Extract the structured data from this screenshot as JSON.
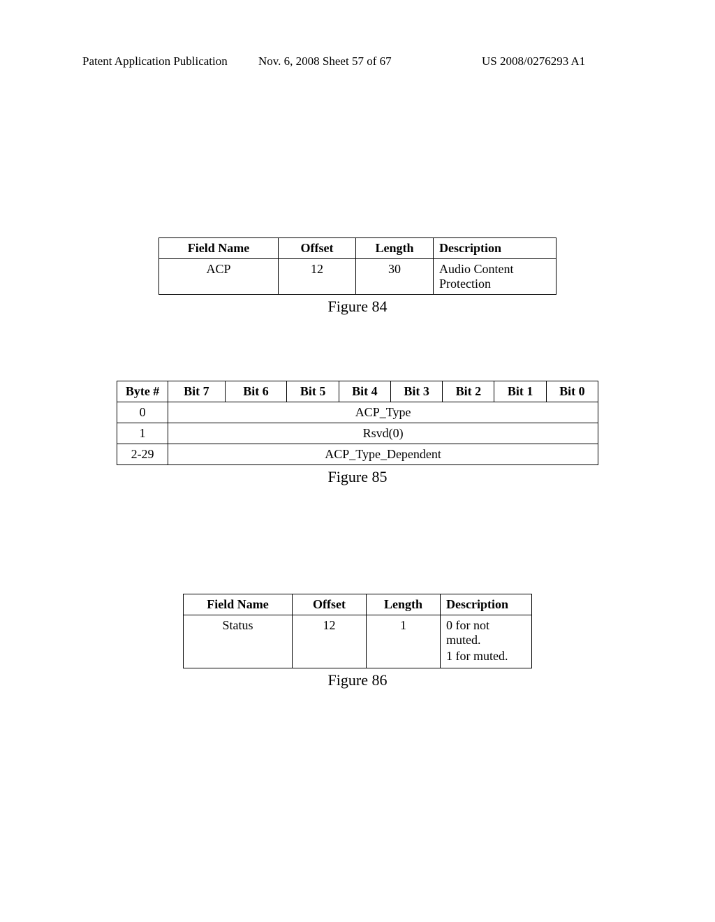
{
  "header": {
    "left": "Patent Application Publication",
    "center": "Nov. 6, 2008  Sheet 57 of 67",
    "right": "US 2008/0276293 A1"
  },
  "figure84": {
    "caption": "Figure 84",
    "headers": {
      "field": "Field Name",
      "offset": "Offset",
      "length": "Length",
      "desc": "Description"
    },
    "row": {
      "field": "ACP",
      "offset": "12",
      "length": "30",
      "desc": "Audio Content Protection"
    }
  },
  "figure85": {
    "caption": "Figure 85",
    "headers": {
      "byte": "Byte #",
      "b7": "Bit 7",
      "b6": "Bit 6",
      "b5": "Bit 5",
      "b4": "Bit 4",
      "b3": "Bit 3",
      "b2": "Bit 2",
      "b1": "Bit 1",
      "b0": "Bit 0"
    },
    "rows": [
      {
        "byte": "0",
        "span": "ACP_Type"
      },
      {
        "byte": "1",
        "span": "Rsvd(0)"
      },
      {
        "byte": "2-29",
        "span": "ACP_Type_Dependent"
      }
    ]
  },
  "figure86": {
    "caption": "Figure 86",
    "headers": {
      "field": "Field Name",
      "offset": "Offset",
      "length": "Length",
      "desc": "Description"
    },
    "row": {
      "field": "Status",
      "offset": "12",
      "length": "1",
      "desc1": "0 for not muted.",
      "desc2": "1 for muted."
    }
  }
}
